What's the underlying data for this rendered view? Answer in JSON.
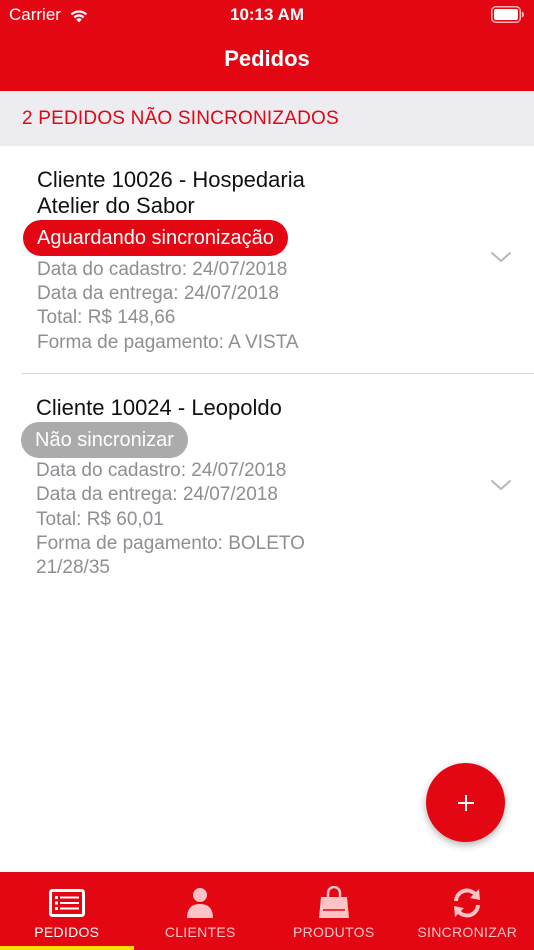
{
  "status_bar": {
    "carrier": "Carrier",
    "time": "10:13 AM"
  },
  "header": {
    "title": "Pedidos"
  },
  "section": {
    "label": "2 PEDIDOS NÃO SINCRONIZADOS"
  },
  "orders": [
    {
      "client_line1": "Cliente 10026 - Hospedaria",
      "client_line2": "Atelier do Sabor",
      "status": "Aguardando sincronização",
      "status_color": "#e30613",
      "cadastro": "Data do cadastro: 24/07/2018",
      "entrega": "Data da entrega: 24/07/2018",
      "total": "Total: R$ 148,66",
      "pagamento": "Forma de pagamento: A VISTA"
    },
    {
      "client_line1": "Cliente 10024 - Leopoldo",
      "status": "Não sincronizar",
      "status_color": "#ababab",
      "cadastro": "Data do cadastro: 24/07/2018",
      "entrega": "Data da entrega: 24/07/2018",
      "total": "Total: R$ 60,01",
      "pagamento_line1": "Forma de pagamento: BOLETO",
      "pagamento_line2": "21/28/35"
    }
  ],
  "fab": {
    "icon": "plus-icon"
  },
  "tabs": [
    {
      "label": "PEDIDOS",
      "icon": "list-icon",
      "active": true
    },
    {
      "label": "CLIENTES",
      "icon": "user-icon",
      "active": false
    },
    {
      "label": "PRODUTOS",
      "icon": "shopping-bag-icon",
      "active": false
    },
    {
      "label": "SINCRONIZAR",
      "icon": "sync-icon",
      "active": false
    }
  ],
  "colors": {
    "brand": "#e30613",
    "tab_indicator": "#fde000",
    "muted_text": "#8e8e93",
    "section_bg": "#ececf1"
  }
}
